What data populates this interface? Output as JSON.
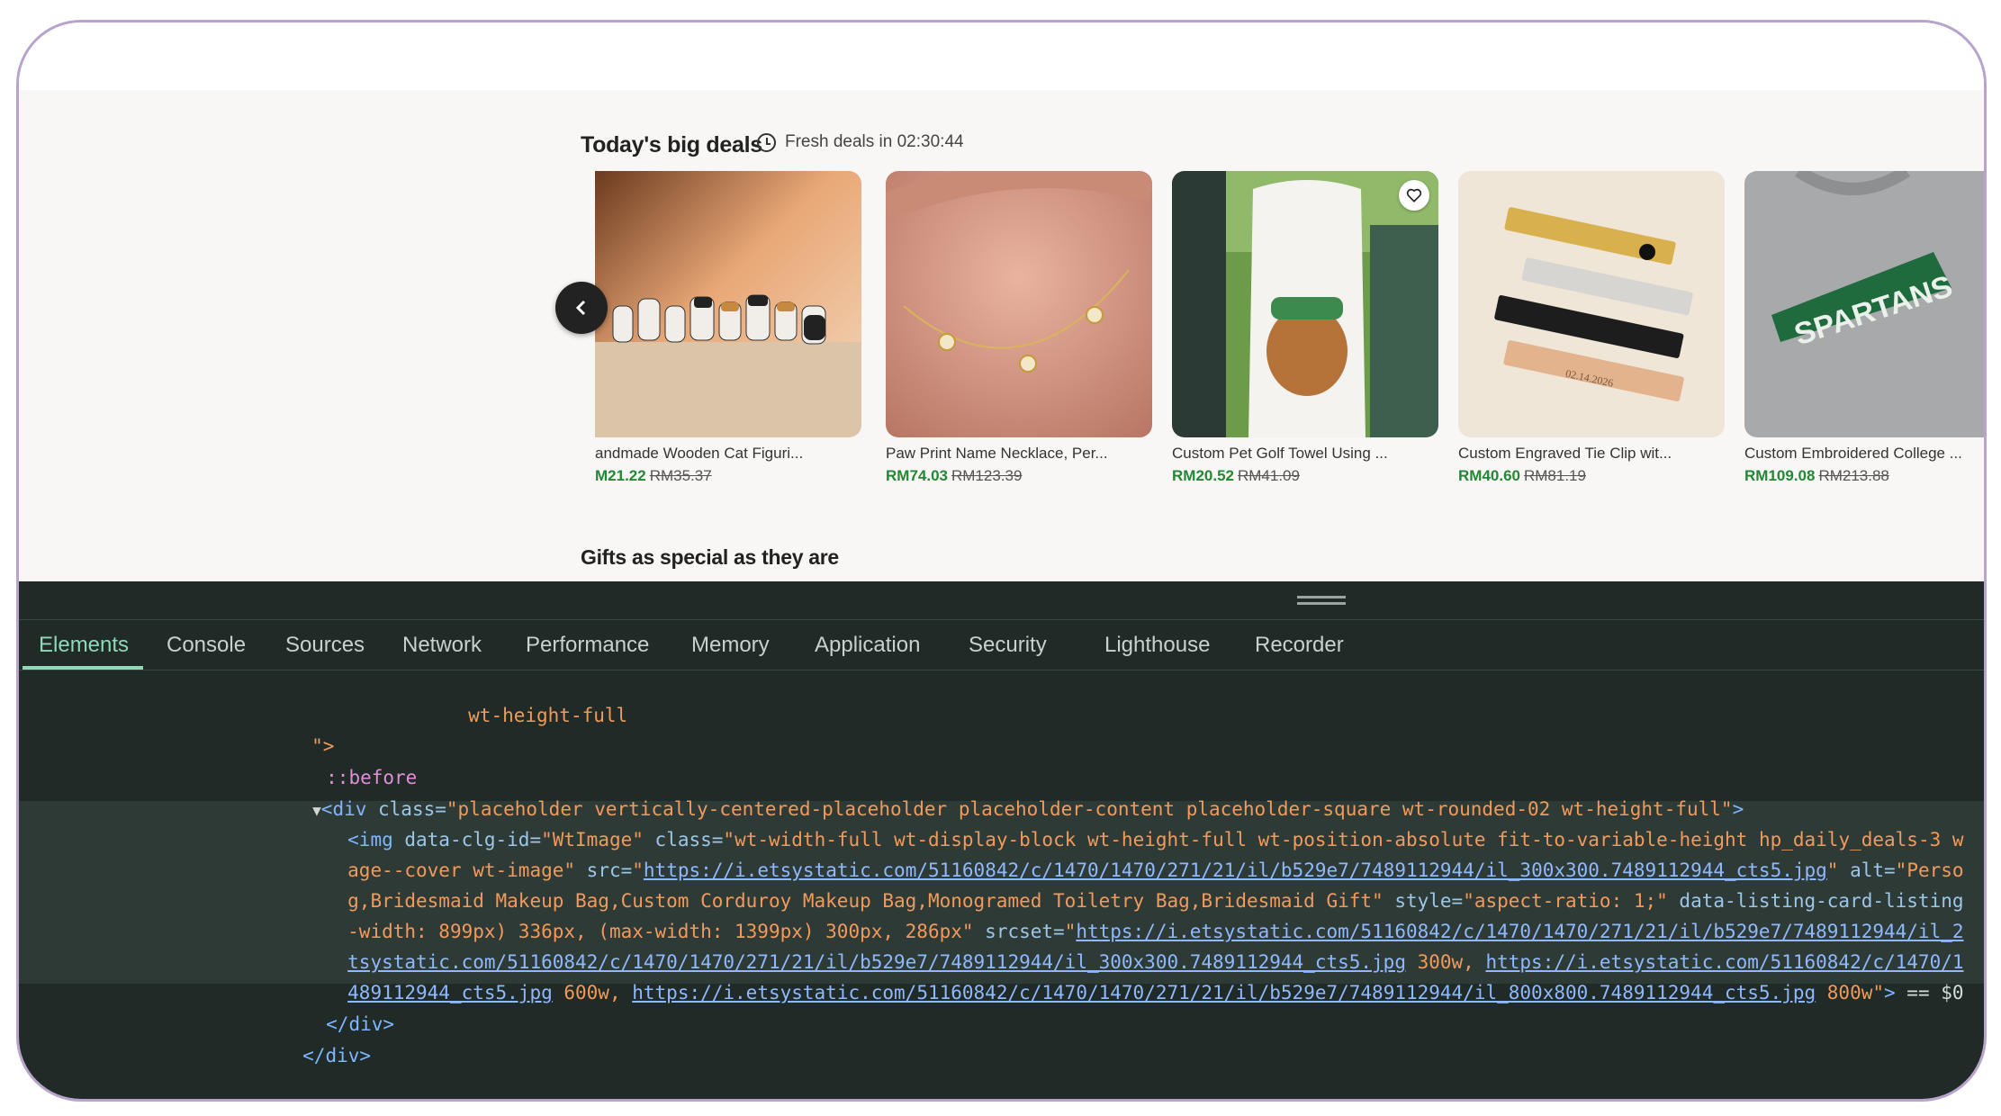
{
  "page": {
    "deals_title": "Today's big deals",
    "timer_text": "Fresh deals in 02:30:44",
    "gifts_title": "Gifts as special as they are",
    "icons": {
      "timer": "clock-icon",
      "prev": "chevron-left-icon",
      "favorite": "heart-icon"
    },
    "colors": {
      "sale_price": "#258635",
      "page_bg": "#f8f7f5",
      "devtools_bg": "#202a26",
      "devtools_accent": "#8fd8b8"
    }
  },
  "cards": [
    {
      "title": "andmade Wooden Cat Figuri...",
      "price": "M21.22",
      "original": "RM35.37"
    },
    {
      "title": "Paw Print Name Necklace, Per...",
      "price": "RM74.03",
      "original": "RM123.39"
    },
    {
      "title": "Custom Pet Golf Towel Using ...",
      "price": "RM20.52",
      "original": "RM41.09"
    },
    {
      "title": "Custom Engraved Tie Clip wit...",
      "price": "RM40.60",
      "original": "RM81.19"
    },
    {
      "title": "Custom Embroidered College ...",
      "price": "RM109.08",
      "original": "RM213.88"
    }
  ],
  "image_text": {
    "tie_clip_date": "02.14.2026",
    "sweatshirt": "SPARTANS"
  },
  "devtools": {
    "tabs": [
      "Elements",
      "Console",
      "Sources",
      "Network",
      "Performance",
      "Memory",
      "Application",
      "Security",
      "Lighthouse",
      "Recorder"
    ],
    "code": {
      "l1": "wt-height-full",
      "l2": "\">",
      "l3": "::before",
      "l4_tag_open": "<div",
      "l4_attr": " class=",
      "l4_val": "\"placeholder vertically-centered-placeholder placeholder-content placeholder-square wt-rounded-02 wt-height-full\"",
      "l4_close": ">",
      "l5_tag": "<img",
      "l5_a1": " data-clg-id=",
      "l5_v1": "\"WtImage\"",
      "l5_a2": " class=",
      "l5_v2": "\"wt-width-full wt-display-block wt-height-full wt-position-absolute fit-to-variable-height hp_daily_deals-3 w",
      "l6_v": "age--cover wt-image\"",
      "l6_a": " src=",
      "l6_q": "\"",
      "l6_link": "https://i.etsystatic.com/51160842/c/1470/1470/271/21/il/b529e7/7489112944/il_300x300.7489112944_cts5.jpg",
      "l6_tail_q": "\"",
      "l6_a2": " alt=",
      "l6_v2": "\"Perso",
      "l7_v": "g,Bridesmaid Makeup Bag,Custom Corduroy Makeup Bag,Monogramed Toiletry Bag,Bridesmaid Gift\"",
      "l7_a": " style=",
      "l7_v2": "\"aspect-ratio: 1;\"",
      "l7_a2": " data-listing-card-listing",
      "l8_v": "-width: 899px) 336px, (max-width: 1399px) 300px, 286px\"",
      "l8_a": " srcset=",
      "l8_q": "\"",
      "l8_link": "https://i.etsystatic.com/51160842/c/1470/1470/271/21/il/b529e7/7489112944/il_2",
      "l9_link1": "tsystatic.com/51160842/c/1470/1470/271/21/il/b529e7/7489112944/il_300x300.7489112944_cts5.jpg",
      "l9_t1": " 300w, ",
      "l9_link2": "https://i.etsystatic.com/51160842/c/1470/1",
      "l10_link1": "489112944_cts5.jpg",
      "l10_t1": " 600w, ",
      "l10_link2": "https://i.etsystatic.com/51160842/c/1470/1470/271/21/il/b529e7/7489112944/il_800x800.7489112944_cts5.jpg",
      "l10_t2": " 800w\"",
      "l10_close": ">",
      "l10_eq": " == $0",
      "l11": "</div>",
      "l12": "</div>"
    }
  }
}
